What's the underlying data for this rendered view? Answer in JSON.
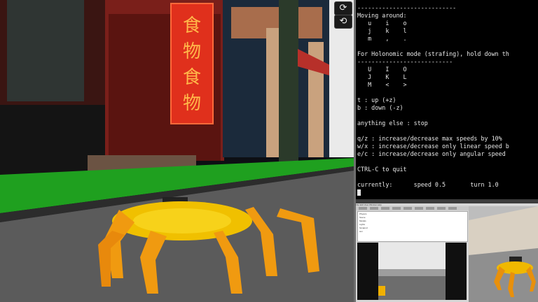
{
  "simulation": {
    "sign_text": [
      "食",
      "物",
      "食",
      "物"
    ],
    "controls": [
      {
        "name": "refresh-icon",
        "glyph": "⟳"
      },
      {
        "name": "rotate-icon",
        "glyph": "⟲"
      }
    ]
  },
  "terminal": {
    "lines": [
      "----------------------------",
      "Moving around:",
      "   u    i    o",
      "   j    k    l",
      "   m    ,    .",
      "",
      "For Holonomic mode (strafing), hold down th",
      "---------------------------",
      "   U    I    O",
      "   J    K    L",
      "   M    <    >",
      "",
      "t : up (+z)",
      "b : down (-z)",
      "",
      "anything else : stop",
      "",
      "q/z : increase/decrease max speeds by 10%",
      "w/x : increase/decrease only linear speed b",
      "e/c : increase/decrease only angular speed",
      "",
      "CTRL-C to quit",
      "",
      "currently:      speed 0.5       turn 1.0"
    ],
    "expand_glyph": "⤢"
  },
  "desktop": {
    "menu": "File  Edit  View  Window  Help",
    "tree_rows": [
      "Physics",
      "Scene",
      "Models",
      "Lights",
      "hexapod",
      "sun"
    ]
  }
}
